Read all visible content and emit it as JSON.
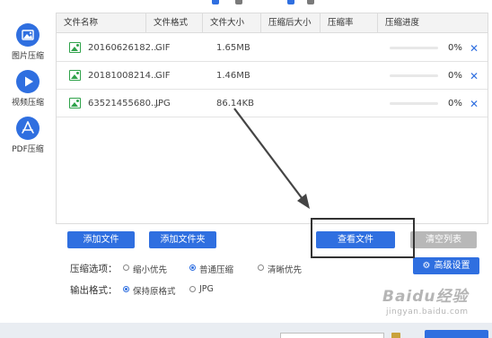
{
  "sidebar": {
    "items": [
      {
        "label": "图片压缩",
        "icon": "image-icon"
      },
      {
        "label": "视频压缩",
        "icon": "play-icon"
      },
      {
        "label": "PDF压缩",
        "icon": "pdf-icon"
      }
    ]
  },
  "table": {
    "headers": [
      "文件名称",
      "文件格式",
      "文件大小",
      "压缩后大小",
      "压缩率",
      "压缩进度"
    ],
    "rows": [
      {
        "name": "20160626182...",
        "format": "GIF",
        "size": "1.65MB",
        "compressed_size": "",
        "rate": "",
        "progress": 0,
        "progress_text": "0%"
      },
      {
        "name": "20181008214...",
        "format": "GIF",
        "size": "1.46MB",
        "compressed_size": "",
        "rate": "",
        "progress": 0,
        "progress_text": "0%"
      },
      {
        "name": "63521455680...",
        "format": "JPG",
        "size": "86.14KB",
        "compressed_size": "",
        "rate": "",
        "progress": 0,
        "progress_text": "0%"
      }
    ],
    "remove_glyph": "✕"
  },
  "actions": {
    "add_file": "添加文件",
    "add_folder": "添加文件夹",
    "view_files": "查看文件",
    "clear_list": "清空列表",
    "advanced": "高级设置"
  },
  "options": {
    "compress_label": "压缩选项：",
    "compress_choices": [
      {
        "label": "缩小优先",
        "selected": false
      },
      {
        "label": "普通压缩",
        "selected": true
      },
      {
        "label": "清晰优先",
        "selected": false
      }
    ],
    "output_label": "输出格式：",
    "output_choices": [
      {
        "label": "保持原格式",
        "selected": true
      },
      {
        "label": "JPG",
        "selected": false
      }
    ]
  },
  "watermark": {
    "main": "Baidu经验",
    "sub": "jingyan.baidu.com"
  },
  "colors": {
    "accent": "#2f6fe0",
    "icon_green": "#2fa24a",
    "clear_button": "#b8b8b8"
  }
}
